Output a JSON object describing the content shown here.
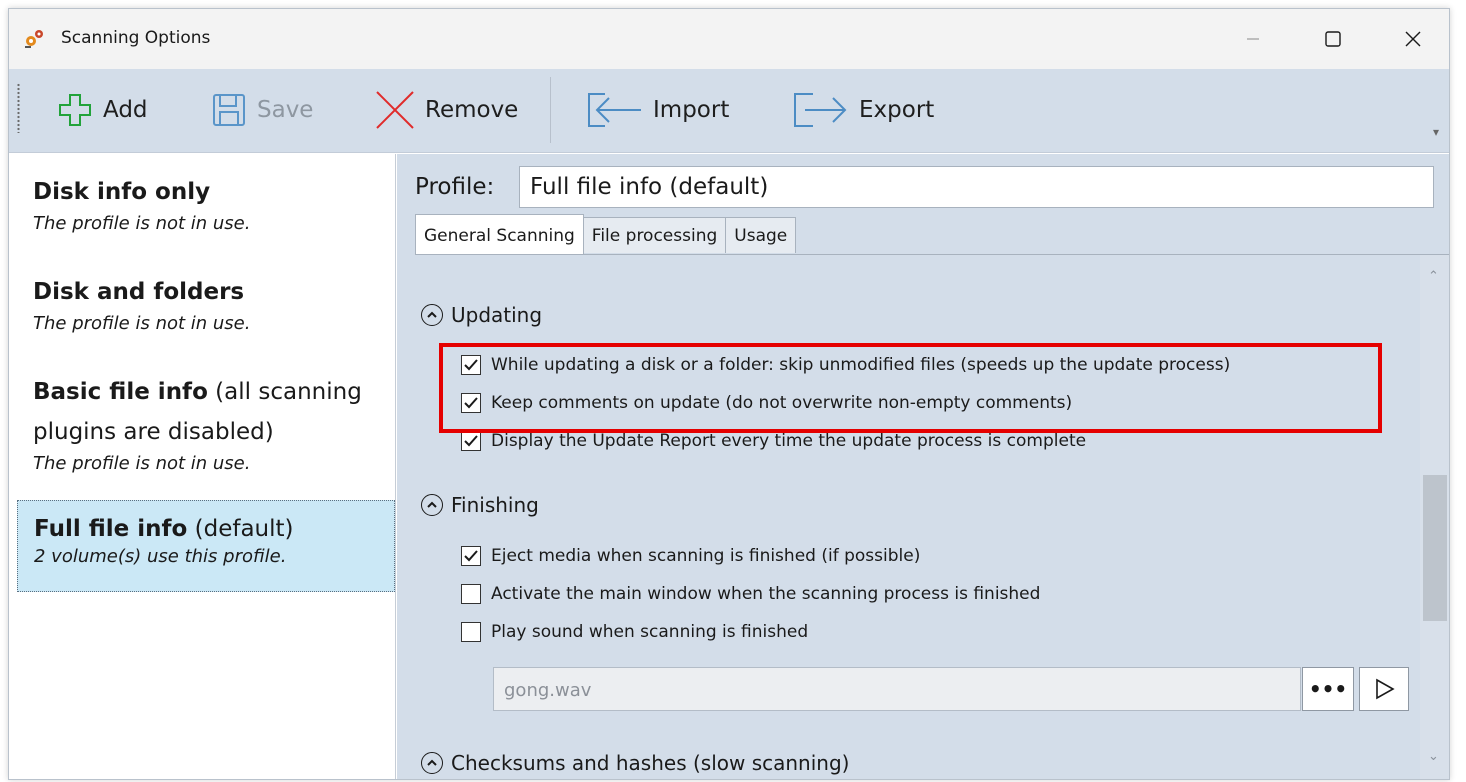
{
  "window": {
    "title": "Scanning Options",
    "icon": "app-scan-icon",
    "controls": {
      "minimize": "minimize-icon",
      "maximize": "maximize-icon",
      "close": "close-icon"
    }
  },
  "toolbar": {
    "add_label": "Add",
    "save_label": "Save",
    "remove_label": "Remove",
    "import_label": "Import",
    "export_label": "Export"
  },
  "profiles": [
    {
      "name_bold": "Disk info only",
      "name_rest": "",
      "status": "The profile is not in use.",
      "selected": false
    },
    {
      "name_bold": "Disk and folders",
      "name_rest": "",
      "status": "The profile is not in use.",
      "selected": false
    },
    {
      "name_bold": "Basic file info",
      "name_rest": " (all scanning plugins are disabled)",
      "status": "The profile is not in use.",
      "selected": false
    },
    {
      "name_bold": "Full file info",
      "name_rest": " (default)",
      "status": "2 volume(s) use this profile.",
      "selected": true
    }
  ],
  "profile_field": {
    "label": "Profile:",
    "value": "Full file info (default)"
  },
  "tabs": [
    {
      "label": "General Scanning",
      "active": true
    },
    {
      "label": "File processing",
      "active": false
    },
    {
      "label": "Usage",
      "active": false
    }
  ],
  "sections": {
    "updating": {
      "title": "Updating",
      "options": [
        {
          "label": "While updating a disk or a folder: skip unmodified files (speeds up the update process)",
          "checked": true
        },
        {
          "label": "Keep comments on update (do not overwrite non-empty comments)",
          "checked": true
        },
        {
          "label": "Display the Update Report every time the update process is complete",
          "checked": true
        }
      ]
    },
    "finishing": {
      "title": "Finishing",
      "options": [
        {
          "label": "Eject media when scanning is finished (if possible)",
          "checked": true
        },
        {
          "label": "Activate the main window when the scanning process is finished",
          "checked": false
        },
        {
          "label": "Play sound when scanning is finished",
          "checked": false
        }
      ],
      "sound_file": "gong.wav",
      "browse_label": "•••"
    },
    "checksums": {
      "title": "Checksums and hashes (slow scanning)"
    }
  },
  "colors": {
    "highlight": "#e50000",
    "panel": "#d3dde9",
    "selected_profile": "#cbe8f6"
  }
}
